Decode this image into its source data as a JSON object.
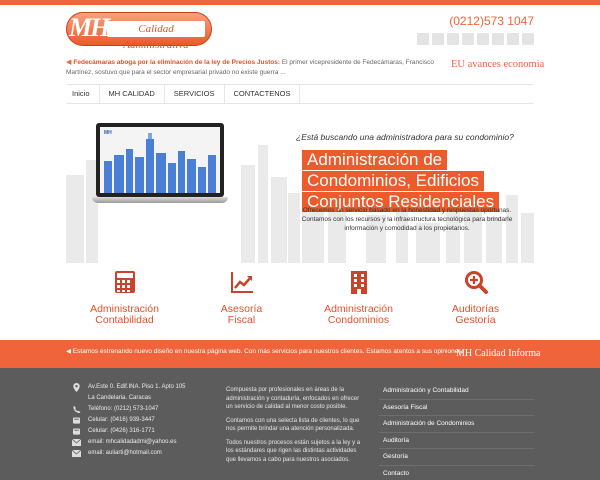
{
  "header": {
    "logo_initials": "MH",
    "logo_text": "Calidad Administrativa",
    "phone": "(0212)573 1047",
    "social_icons": [
      "twitter-icon",
      "vimeo-icon",
      "facebook-icon",
      "flickr-icon",
      "instagram-icon",
      "googleplus-icon",
      "linkedin-icon",
      "rss-icon"
    ]
  },
  "news": {
    "headline": "Fedecámaras aboga por la eliminación de la ley de Precios Justos:",
    "body": "El primer vicepresidente de Fedecámaras, Francisco Martínez, sostuvo que para el sector empresarial privado no existe guerra ...",
    "side_title": "EU avances economia"
  },
  "nav": {
    "items": [
      "Inicio",
      "MH Calidad",
      "Servicios",
      "Contactenos"
    ]
  },
  "banner": {
    "laptop_logo": "MH",
    "question": "¿Está buscando una administradora para su condominio?",
    "title_lines": [
      "Administración de",
      "Condominios, Edificios",
      "Conjuntos Residenciales"
    ],
    "description": "Ofrecemos un servicio basado en la honestidad y respuestas oportunas. Contamos con los recursos y la infraestructura tecnológica para brindarle información y comodidad a los propietarios."
  },
  "services": [
    {
      "icon": "calculator-icon",
      "line1": "Administración",
      "line2": "Contabilidad"
    },
    {
      "icon": "chart-line-icon",
      "line1": "Asesoría",
      "line2": "Fiscal"
    },
    {
      "icon": "building-icon",
      "line1": "Administración",
      "line2": "Condominios"
    },
    {
      "icon": "search-plus-icon",
      "line1": "Auditorías",
      "line2": "Gestoría"
    }
  ],
  "promo": {
    "text": "Estamos estrenando nuevo diseño en nuestra página web. Con más servicios para nuestros clientes. Estamos atentos a sus opiniones.",
    "right": "MH Calidad Informa"
  },
  "footer": {
    "contact": [
      {
        "icon": "map-marker-icon",
        "text": "Av.Este 0. Edif.INA. Piso 1. Apto 105"
      },
      {
        "icon": "",
        "text": "La Candelaria. Caracas"
      },
      {
        "icon": "phone-icon",
        "text": "Teléfono: (0212) 573-1047"
      },
      {
        "icon": "mobile-icon",
        "text": "Celular: (0416) 939-3447"
      },
      {
        "icon": "mobile-icon",
        "text": "Celular: (0426) 316-1771"
      },
      {
        "icon": "envelope-icon",
        "text": "email: mhcalidadadmi@yahoo.es"
      },
      {
        "icon": "envelope-icon",
        "text": "email: auliarti@hotmail.com"
      }
    ],
    "about": [
      "Compuesta por profesionales en áreas de la administración y contaduría, enfocados en ofrecer un servicio de calidad al menor costo posible.",
      "Contamos con una selecta lista de clientes, lo que nos permite brindar una atención personalizada.",
      "Todos nuestros procesos están sujetos a la ley y a los estándares que rigen las distintas actividades que llevamos a cabo para nuestros asociados."
    ],
    "links": [
      "Administración y Contabilidad",
      "Asesoría Fiscal",
      "Administración de Condominios",
      "Auditoría",
      "Gestoría",
      "Contacto"
    ]
  },
  "colors": {
    "accent": "#f0643c",
    "footer_bg": "#5c5c5c"
  }
}
